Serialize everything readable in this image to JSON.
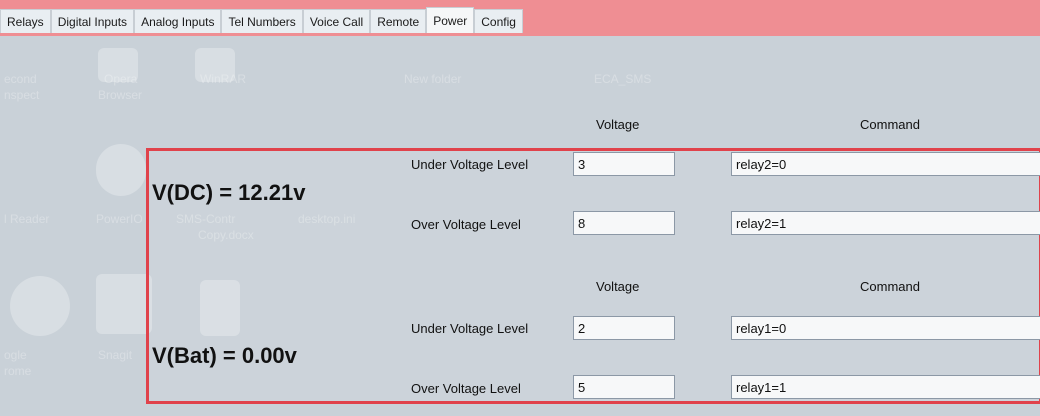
{
  "tabs": [
    "Relays",
    "Digital Inputs",
    "Analog Inputs",
    "Tel Numbers",
    "Voice Call",
    "Remote",
    "Power",
    "Config"
  ],
  "active_tab": "Power",
  "desktop_labels": [
    "econd",
    "nspect",
    "Opera",
    "Browser",
    "WinRAR",
    "New folder",
    "ECA_SMS",
    "l Reader",
    "PowerIO",
    "SMS-Contr",
    "Copy.docx",
    "desktop.ini",
    "ogle",
    "rome",
    "Snagit"
  ],
  "colors": {
    "accent_red": "#e0424b",
    "topbar": "#ef8e93"
  },
  "dc": {
    "value_label": "V(DC) = 12.21v",
    "col_voltage": "Voltage",
    "col_command": "Command",
    "under_label": "Under Voltage Level",
    "under_voltage": "3",
    "under_command": "relay2=0",
    "over_label": "Over Voltage Level",
    "over_voltage": "8",
    "over_command": "relay2=1"
  },
  "bat": {
    "value_label": "V(Bat) = 0.00v",
    "col_voltage": "Voltage",
    "col_command": "Command",
    "under_label": "Under Voltage Level",
    "under_voltage": "2",
    "under_command": "relay1=0",
    "over_label": "Over Voltage Level",
    "over_voltage": "5",
    "over_command": "relay1=1"
  }
}
